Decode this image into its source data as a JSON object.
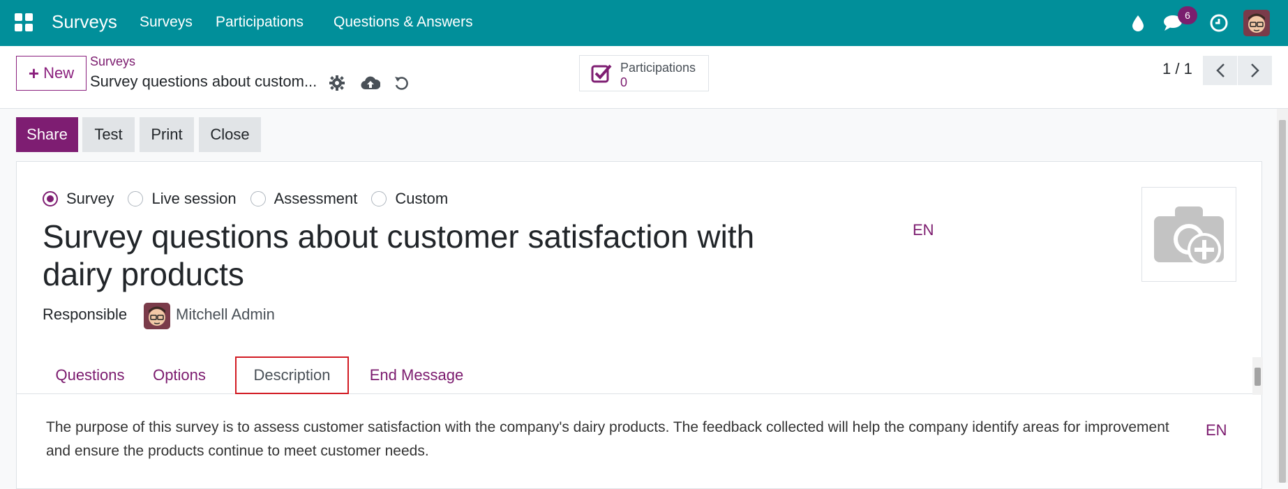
{
  "navbar": {
    "brand": "Surveys",
    "menu": [
      "Surveys",
      "Participations",
      "Questions & Answers"
    ],
    "chat_badge": "6",
    "icons": [
      "apps-icon",
      "droplet-icon",
      "chat-icon",
      "clock-icon",
      "user-avatar"
    ]
  },
  "control": {
    "new_label": "New",
    "breadcrumb_parent": "Surveys",
    "breadcrumb_current": "Survey questions about custom...",
    "smart_button": {
      "label": "Participations",
      "value": "0"
    },
    "pager": "1 / 1"
  },
  "statusbar": {
    "buttons": [
      "Share",
      "Test",
      "Print",
      "Close"
    ]
  },
  "form": {
    "survey_types": [
      "Survey",
      "Live session",
      "Assessment",
      "Custom"
    ],
    "selected_type": "Survey",
    "title": "Survey questions about customer satisfaction with dairy products",
    "lang": "EN",
    "responsible_label": "Responsible",
    "responsible_name": "Mitchell Admin",
    "tabs": [
      "Questions",
      "Options",
      "Description",
      "End Message"
    ],
    "active_tab": "Description",
    "description": "The purpose of this survey is to assess customer satisfaction with the company's dairy products. The feedback collected will help the company identify areas for improvement and ensure the products continue to meet customer needs.",
    "description_lang": "EN"
  },
  "colors": {
    "navbar": "#018f9a",
    "primary": "#7e1d72",
    "highlight": "#d21b23"
  }
}
